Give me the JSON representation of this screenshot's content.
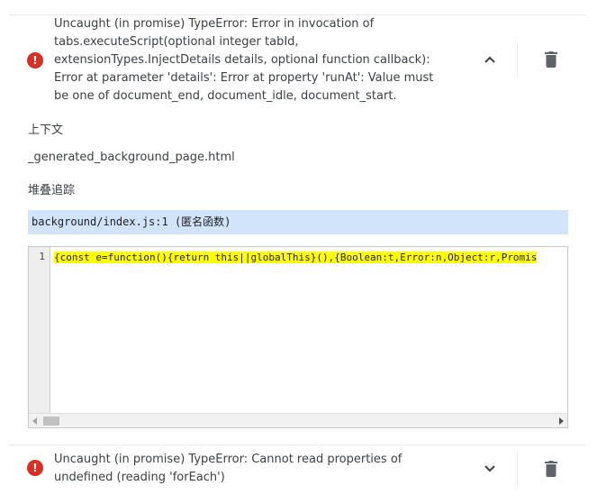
{
  "errors": [
    {
      "message": "Uncaught (in promise) TypeError: Error in invocation of tabs.executeScript(optional integer tabId, extensionTypes.InjectDetails details, optional function callback): Error at parameter 'details': Error at property 'runAt': Value must be one of document_end, document_idle, document_start.",
      "expand_icon": "chevron-up-icon",
      "delete_icon": "trash-icon"
    },
    {
      "message": "Uncaught (in promise) TypeError: Cannot read properties of undefined (reading 'forEach')",
      "expand_icon": "chevron-down-icon",
      "delete_icon": "trash-icon"
    }
  ],
  "details": {
    "context_label": "上下文",
    "context_value": "_generated_background_page.html",
    "stack_label": "堆叠追踪",
    "stack_frame": "background/index.js:1 (匿名函数)"
  },
  "code": {
    "line_number": "1",
    "line_text": "{const e=function(){return this||globalThis}(),{Boolean:t,Error:n,Object:r,Promis"
  },
  "colors": {
    "error_red": "#d93025",
    "stack_highlight": "#d2e3fc",
    "code_highlight": "#ffff00"
  }
}
